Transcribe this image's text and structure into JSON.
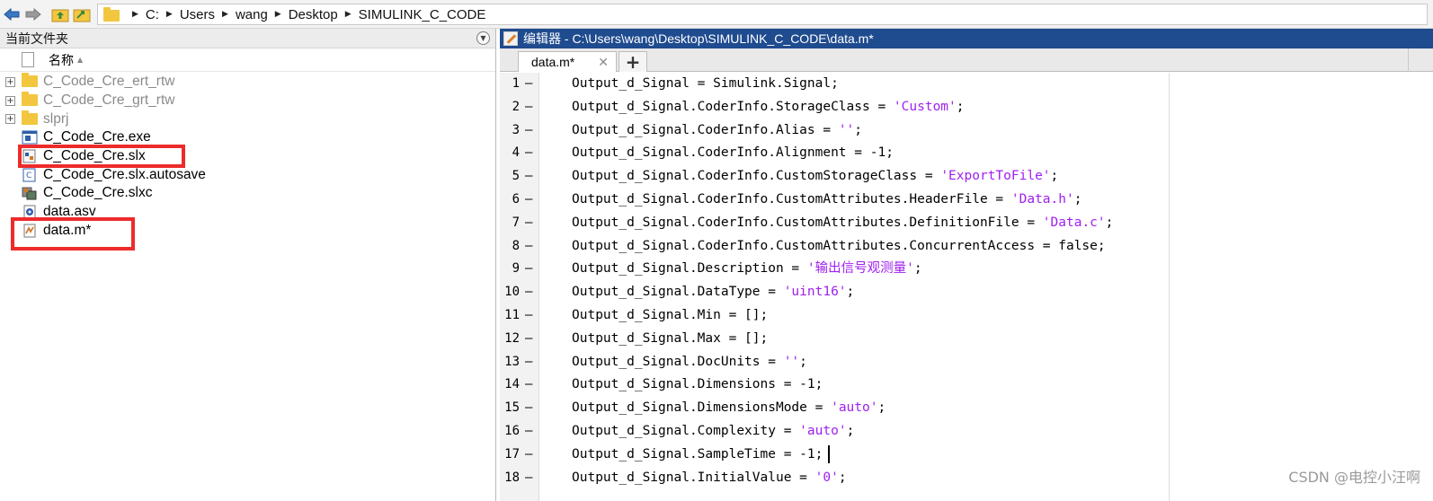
{
  "address": {
    "crumbs": [
      "C:",
      "Users",
      "wang",
      "Desktop",
      "SIMULINK_C_CODE"
    ]
  },
  "current_folder": {
    "title": "当前文件夹",
    "column_name": "名称",
    "items": [
      {
        "label": "C_Code_Cre_ert_rtw",
        "type": "folder",
        "expandable": true,
        "dim": true
      },
      {
        "label": "C_Code_Cre_grt_rtw",
        "type": "folder",
        "expandable": true,
        "dim": true
      },
      {
        "label": "slprj",
        "type": "folder",
        "expandable": true,
        "dim": true
      },
      {
        "label": "C_Code_Cre.exe",
        "type": "exe-icon"
      },
      {
        "label": "C_Code_Cre.slx",
        "type": "slx-icon",
        "highlighted": true
      },
      {
        "label": "C_Code_Cre.slx.autosave",
        "type": "autosave-icon"
      },
      {
        "label": "C_Code_Cre.slxc",
        "type": "slxc-icon"
      },
      {
        "label": "data.asv",
        "type": "asv-icon"
      },
      {
        "label": "data.m*",
        "type": "m-file-icon",
        "highlighted": true
      }
    ]
  },
  "editor": {
    "title": "编辑器 - C:\\Users\\wang\\Desktop\\SIMULINK_C_CODE\\data.m*",
    "tab_label": "data.m*",
    "close_glyph": "✕",
    "add_tab_glyph": "+",
    "lines": [
      {
        "n": "1",
        "pre": "Output_d_Signal = Simulink.Signal;",
        "str": "",
        "post": ""
      },
      {
        "n": "2",
        "pre": "Output_d_Signal.CoderInfo.StorageClass = ",
        "str": "'Custom'",
        "post": ";"
      },
      {
        "n": "3",
        "pre": "Output_d_Signal.CoderInfo.Alias = ",
        "str": "''",
        "post": ";"
      },
      {
        "n": "4",
        "pre": "Output_d_Signal.CoderInfo.Alignment = -1;",
        "str": "",
        "post": ""
      },
      {
        "n": "5",
        "pre": "Output_d_Signal.CoderInfo.CustomStorageClass = ",
        "str": "'ExportToFile'",
        "post": ";"
      },
      {
        "n": "6",
        "pre": "Output_d_Signal.CoderInfo.CustomAttributes.HeaderFile = ",
        "str": "'Data.h'",
        "post": ";"
      },
      {
        "n": "7",
        "pre": "Output_d_Signal.CoderInfo.CustomAttributes.DefinitionFile = ",
        "str": "'Data.c'",
        "post": ";"
      },
      {
        "n": "8",
        "pre": "Output_d_Signal.CoderInfo.CustomAttributes.ConcurrentAccess = false;",
        "str": "",
        "post": ""
      },
      {
        "n": "9",
        "pre": "Output_d_Signal.Description = ",
        "str": "'输出信号观测量'",
        "post": ";"
      },
      {
        "n": "10",
        "pre": "Output_d_Signal.DataType = ",
        "str": "'uint16'",
        "post": ";"
      },
      {
        "n": "11",
        "pre": "Output_d_Signal.Min = [];",
        "str": "",
        "post": ""
      },
      {
        "n": "12",
        "pre": "Output_d_Signal.Max = [];",
        "str": "",
        "post": ""
      },
      {
        "n": "13",
        "pre": "Output_d_Signal.DocUnits = ",
        "str": "''",
        "post": ";"
      },
      {
        "n": "14",
        "pre": "Output_d_Signal.Dimensions = -1;",
        "str": "",
        "post": ""
      },
      {
        "n": "15",
        "pre": "Output_d_Signal.DimensionsMode = ",
        "str": "'auto'",
        "post": ";"
      },
      {
        "n": "16",
        "pre": "Output_d_Signal.Complexity = ",
        "str": "'auto'",
        "post": ";"
      },
      {
        "n": "17",
        "pre": "Output_d_Signal.SampleTime = -1;",
        "str": "",
        "post": "",
        "caret": true
      },
      {
        "n": "18",
        "pre": "Output_d_Signal.InitialValue = ",
        "str": "'0'",
        "post": ";"
      }
    ]
  },
  "watermark": "CSDN @电控小汪啊",
  "colors": {
    "highlight": "#ee2b2b",
    "string": "#a020f0",
    "title_bar": "#1f4b8f"
  }
}
